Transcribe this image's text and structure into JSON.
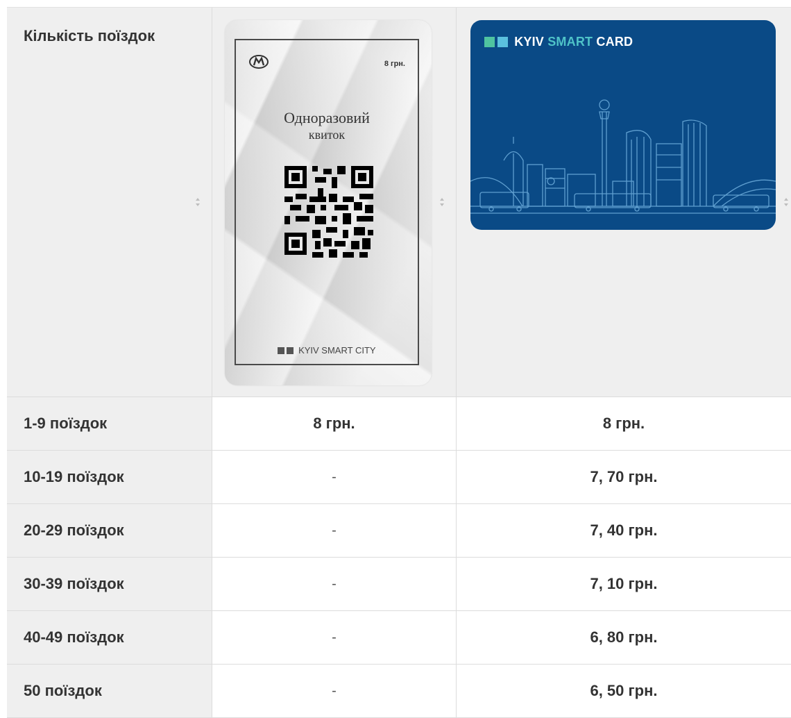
{
  "header": {
    "label": "Кількість поїздок",
    "ticket": {
      "price": "8 грн.",
      "title_line1": "Одноразовий",
      "title_line2": "квиток",
      "footer": "KYIV SMART CITY"
    },
    "card": {
      "brand_word1": "KYIV",
      "brand_word2": "SMART",
      "brand_word3": "CARD",
      "bg_color": "#0a4a86",
      "accent_color": "#4fc3c8"
    }
  },
  "rows": [
    {
      "label": "1-9 поїздок",
      "ticket": "8 грн.",
      "card": "8 грн."
    },
    {
      "label": "10-19 поїздок",
      "ticket": "-",
      "card": "7, 70 грн."
    },
    {
      "label": "20-29 поїздок",
      "ticket": "-",
      "card": "7, 40 грн."
    },
    {
      "label": "30-39 поїздок",
      "ticket": "-",
      "card": "7, 10 грн."
    },
    {
      "label": "40-49 поїздок",
      "ticket": "-",
      "card": "6, 80 грн."
    },
    {
      "label": "50 поїздок",
      "ticket": "-",
      "card": "6, 50 грн."
    }
  ],
  "icons": {
    "sort": "sort-updown-icon",
    "metro": "metro-logo-icon",
    "qr": "qr-code-icon"
  }
}
